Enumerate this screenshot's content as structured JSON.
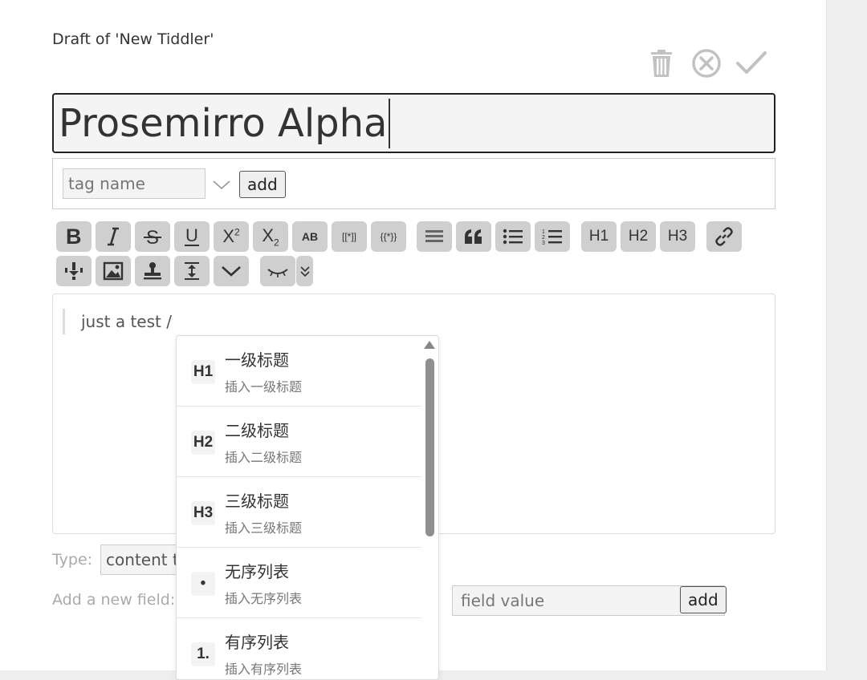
{
  "draft": {
    "heading": "Draft of 'New Tiddler'",
    "title_value": "Prosemirro Alpha"
  },
  "controls": {
    "delete_icon": "trash-icon",
    "cancel_icon": "close-circle-icon",
    "confirm_icon": "checkmark-icon"
  },
  "tags": {
    "placeholder": "tag name",
    "add_label": "add"
  },
  "toolbar": {
    "superscript_label": "X",
    "superscript_sup": "2",
    "subscript_label": "X",
    "subscript_sub": "2",
    "smallcaps_label": "AB",
    "transclude_label": "[[*]]",
    "macro_label": "{{*}}",
    "h1_label": "H1",
    "h2_label": "H2",
    "h3_label": "H3"
  },
  "editor": {
    "content": "just a test /"
  },
  "slash_menu": {
    "items": [
      {
        "icon": "H1",
        "title": "一级标题",
        "desc": "插入一级标题"
      },
      {
        "icon": "H2",
        "title": "二级标题",
        "desc": "插入二级标题"
      },
      {
        "icon": "H3",
        "title": "三级标题",
        "desc": "插入三级标题"
      },
      {
        "icon": "•",
        "title": "无序列表",
        "desc": "插入无序列表"
      },
      {
        "icon": "1.",
        "title": "有序列表",
        "desc": "插入有序列表"
      }
    ]
  },
  "type_row": {
    "label": "Type:",
    "placeholder": "content type"
  },
  "field_row": {
    "label": "Add a new field:",
    "value_placeholder": "field value",
    "add_label": "add"
  }
}
